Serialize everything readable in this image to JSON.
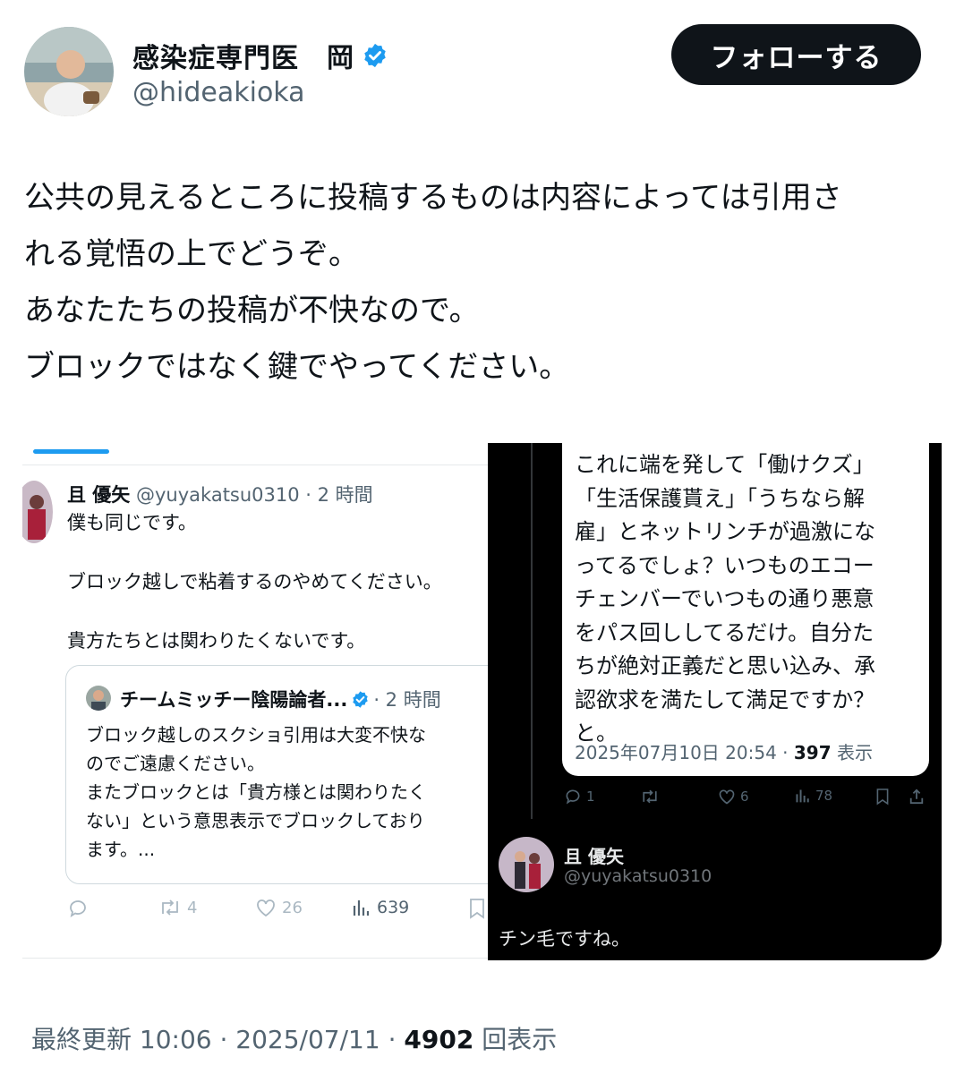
{
  "author": {
    "display_name": "感染症専門医　岡",
    "handle": "@hideakioka"
  },
  "follow_button": {
    "label": "フォローする"
  },
  "tweet": {
    "lines": [
      "公共の見えるところに投稿するものは内容によっては引用さ",
      "れる覚悟の上でどうぞ。",
      "あなたたちの投稿が不快なので。",
      "ブロックではなく鍵でやってください。"
    ]
  },
  "left_screenshot": {
    "name": "且 優矢",
    "meta": "@yuyakatsu0310 · 2 時間",
    "lines": [
      "僕も同じです。",
      "",
      "ブロック越しで粘着するのやめてください。",
      "",
      "貴方たちとは関わりたくないです。"
    ],
    "quote": {
      "name": "チームミッチー陰陽論者...",
      "meta": "· 2 時間",
      "lines": [
        "ブロック越しのスクショ引用は大変不快な",
        "のでご遠慮ください。",
        "またブロックとは「貴方様とは関わりたく",
        "ない」という意思表示でブロックしており",
        "ます。..."
      ]
    },
    "actions": {
      "reply": "",
      "retweets": "4",
      "likes": "26",
      "views": "639"
    }
  },
  "right_screenshot": {
    "bubble_lines": [
      "これに端を発して「働けクズ」",
      "「生活保護貰え」「うちなら解",
      "雇」とネットリンチが過激にな",
      "ってるでしょ？いつものエコー",
      "チェンバーでいつもの通り悪意",
      "をパス回ししてるだけ。自分た",
      "ちが絶対正義だと思い込み、承",
      "認欲求を満たして満足ですか？",
      "と。"
    ],
    "bubble_date": "2025年07月10日 20:54 · ",
    "bubble_views": "397",
    "bubble_views_label": " 表示",
    "actions": {
      "replies": "1",
      "retweets": "",
      "likes": "6",
      "views": "78"
    },
    "reply_name": "且 優矢",
    "reply_handle": "@yuyakatsu0310",
    "reply_text": "チン毛ですね。"
  },
  "footer": {
    "prefix": "最終更新 10:06 · 2025/07/11 · ",
    "views": "4902",
    "views_label": " 回表示"
  }
}
